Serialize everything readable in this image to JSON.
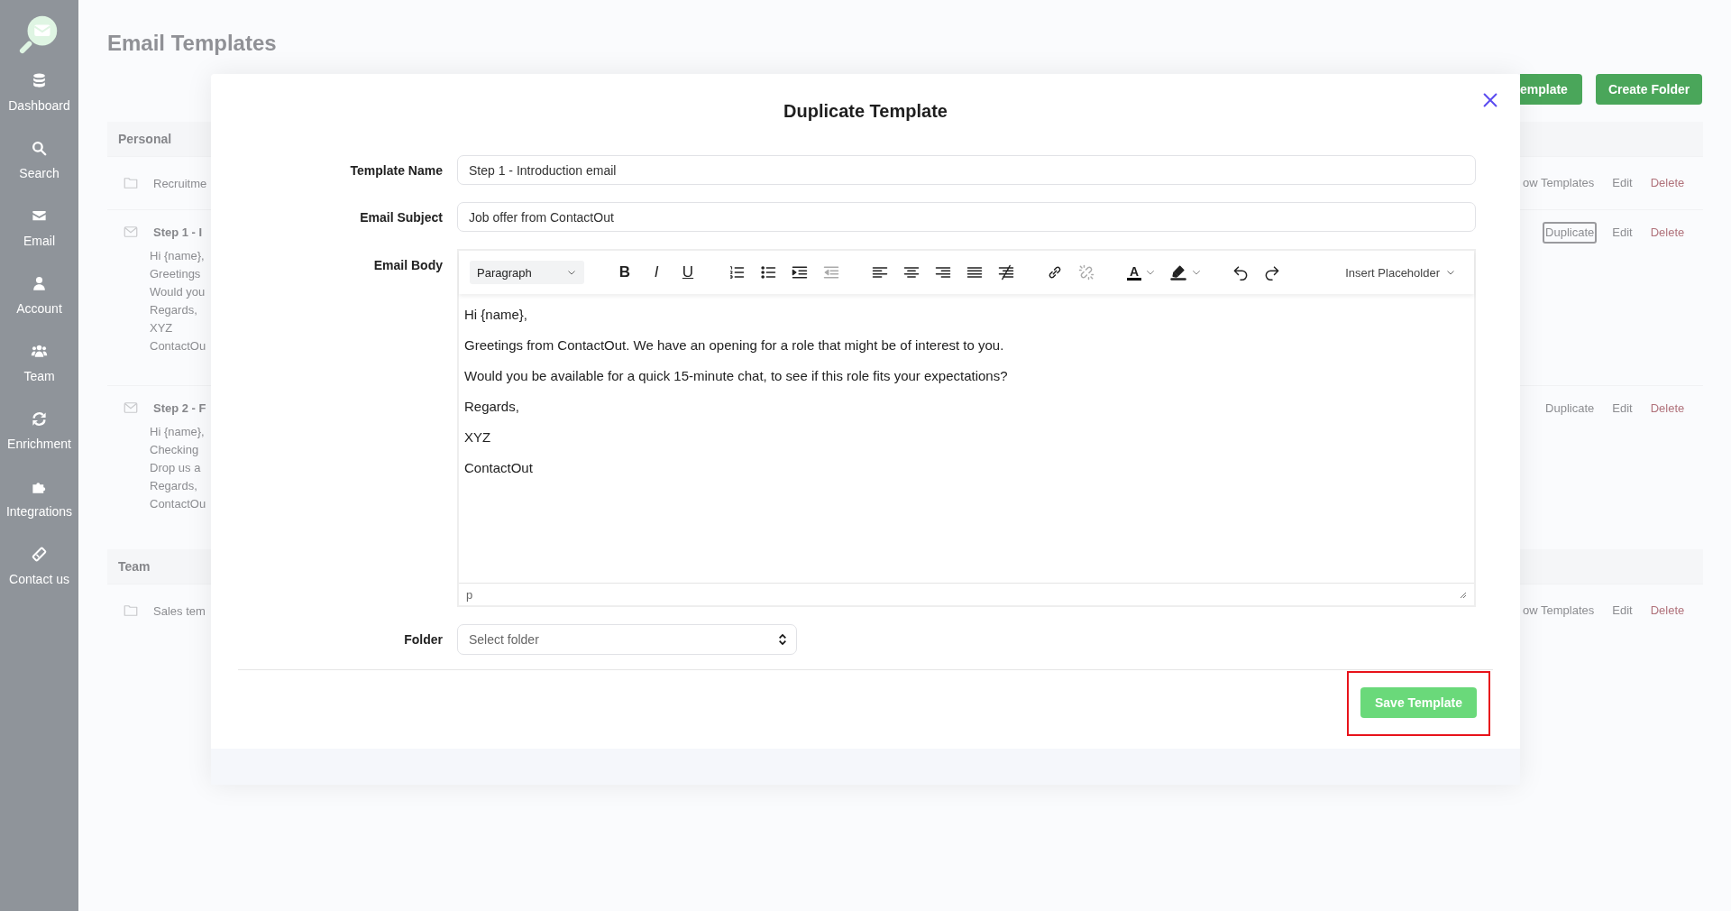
{
  "sidebar": {
    "items": [
      {
        "label": "Dashboard"
      },
      {
        "label": "Search"
      },
      {
        "label": "Email"
      },
      {
        "label": "Account"
      },
      {
        "label": "Team"
      },
      {
        "label": "Enrichment"
      },
      {
        "label": "Integrations"
      },
      {
        "label": "Contact us"
      }
    ]
  },
  "page": {
    "title": "Email Templates",
    "buttons": [
      "emplate",
      "Create Folder"
    ],
    "sections": [
      {
        "title": "Personal",
        "rows": [
          {
            "kind": "folder",
            "name": "Recruitme",
            "actions": [
              {
                "label": "ow Templates",
                "kind": "link",
                "focused": false
              },
              {
                "label": "Edit",
                "kind": "link",
                "focused": false
              },
              {
                "label": "Delete",
                "kind": "danger",
                "focused": false
              }
            ]
          },
          {
            "kind": "template",
            "name": "Step 1 - I",
            "preview": [
              "Hi {name},",
              "Greetings",
              "Would you",
              "Regards,",
              "XYZ",
              "ContactOu"
            ],
            "actions": [
              {
                "label": "Duplicate",
                "kind": "link",
                "focused": true
              },
              {
                "label": "Edit",
                "kind": "link",
                "focused": false
              },
              {
                "label": "Delete",
                "kind": "danger",
                "focused": false
              }
            ]
          },
          {
            "kind": "template",
            "name": "Step 2 - F",
            "preview": [
              "Hi {name},",
              "Checking",
              "Drop us a",
              "Regards,",
              "ContactOu"
            ],
            "actions": [
              {
                "label": "Duplicate",
                "kind": "link",
                "focused": false
              },
              {
                "label": "Edit",
                "kind": "link",
                "focused": false
              },
              {
                "label": "Delete",
                "kind": "danger",
                "focused": false
              }
            ]
          }
        ]
      },
      {
        "title": "Team",
        "rows": [
          {
            "kind": "folder",
            "name": "Sales tem",
            "actions": [
              {
                "label": "ow Templates",
                "kind": "link",
                "focused": false
              },
              {
                "label": "Edit",
                "kind": "link",
                "focused": false
              },
              {
                "label": "Delete",
                "kind": "danger",
                "focused": false
              }
            ]
          }
        ]
      }
    ]
  },
  "dialog": {
    "title": "Duplicate Template",
    "fields": [
      {
        "label": "Template Name",
        "value": "Step 1 - Introduction email"
      },
      {
        "label": "Email Subject",
        "value": "Job offer from ContactOut"
      }
    ],
    "body": {
      "label": "Email Body",
      "toolbar": {
        "block_format": "Paragraph",
        "groups": [
          [
            {
              "kind": "button",
              "label": "B",
              "disabled": false
            },
            {
              "kind": "button",
              "label": "I",
              "disabled": false
            },
            {
              "kind": "button",
              "label": "U",
              "disabled": false
            }
          ],
          [
            {
              "kind": "button",
              "disabled": false
            },
            {
              "kind": "button",
              "disabled": false
            },
            {
              "kind": "button",
              "disabled": false
            },
            {
              "kind": "button",
              "disabled": true
            }
          ],
          [
            {
              "kind": "button",
              "disabled": false
            },
            {
              "kind": "button",
              "disabled": false
            },
            {
              "kind": "button",
              "disabled": false
            },
            {
              "kind": "button",
              "disabled": false
            },
            {
              "kind": "button",
              "disabled": false
            }
          ],
          [
            {
              "kind": "button",
              "disabled": false
            },
            {
              "kind": "button",
              "disabled": true
            }
          ],
          [
            {
              "kind": "split",
              "label": "A",
              "disabled": false
            },
            {
              "kind": "split",
              "disabled": false
            }
          ],
          [
            {
              "kind": "button",
              "disabled": false
            },
            {
              "kind": "button",
              "disabled": false
            }
          ]
        ],
        "insert_placeholder": "Insert Placeholder"
      },
      "lines": [
        "Hi {name},",
        "Greetings from ContactOut. We have an opening for a role that might be of interest to you.",
        "Would you be available for a quick 15-minute chat, to see if this role fits your expectations?",
        "Regards,",
        "XYZ",
        "ContactOut"
      ],
      "status": "p"
    },
    "folder": {
      "label": "Folder",
      "placeholder": "Select folder"
    },
    "save": {
      "label": "Save Template",
      "highlighted": true
    }
  }
}
